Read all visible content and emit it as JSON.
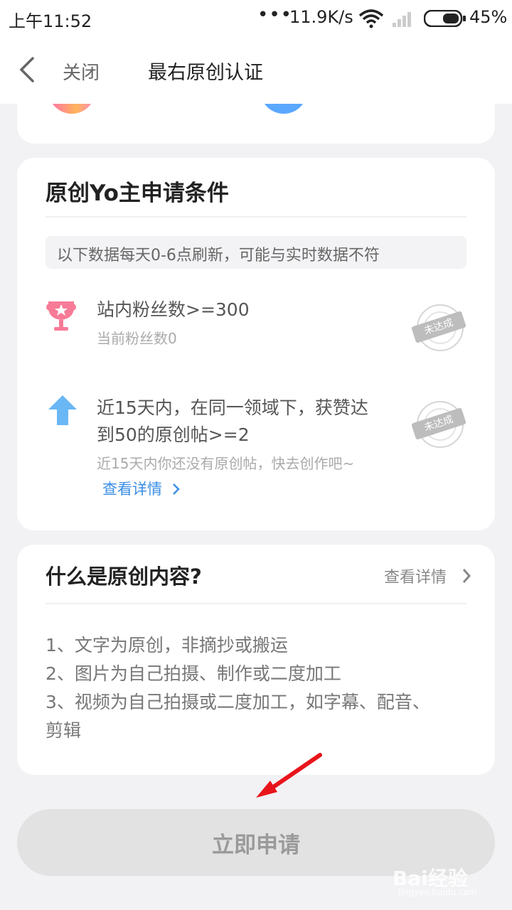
{
  "status_bar": {
    "time": "上午11:52",
    "dots": "•••",
    "network_speed": "11.9K/s",
    "battery": "45%"
  },
  "nav": {
    "close_label": "关闭",
    "title": "最右原创认证"
  },
  "conditions": {
    "heading": "原创Yo主申请条件",
    "notice": "以下数据每天0-6点刷新，可能与实时数据不符",
    "items": [
      {
        "title": "站内粉丝数>=300",
        "subtitle": "当前粉丝数0",
        "status": "未达成",
        "icon": "trophy-icon"
      },
      {
        "title_line1": "近15天内，在同一领域下，获赞达",
        "title_line2": "到50的原创帖>=2",
        "subtitle": "近15天内你还没有原创帖，快去创作吧~",
        "link": "查看详情",
        "status": "未达成",
        "icon": "up-arrow-icon"
      }
    ]
  },
  "what_is_original": {
    "heading": "什么是原创内容?",
    "detail_link": "查看详情",
    "rules": [
      "1、文字为原创，非摘抄或搬运",
      "2、图片为自己拍摄、制作或二度加工",
      "3、视频为自己拍摄或二度加工，如字幕、配音、",
      "剪辑"
    ]
  },
  "apply_button": "立即申请",
  "watermark": "Bai经验",
  "watermark_url": "jingyan.baidu.com",
  "colors": {
    "accent_link": "#3a8ee6",
    "annotation_arrow": "#e8141b",
    "page_bg": "#f2f2f4"
  }
}
